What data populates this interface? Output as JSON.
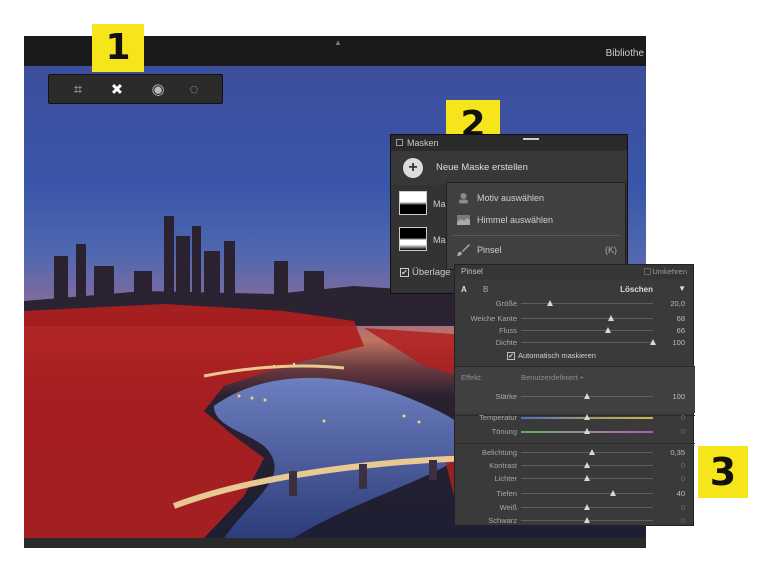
{
  "topbar": {
    "library_label": "Bibliothe"
  },
  "tools": [
    {
      "name": "crop-icon",
      "glyph": "⌗"
    },
    {
      "name": "healing-bandage-icon",
      "glyph": "✚"
    },
    {
      "name": "red-eye-icon",
      "glyph": "◉"
    },
    {
      "name": "masking-icon",
      "glyph": "◌"
    }
  ],
  "badges": {
    "one": "1",
    "two": "2",
    "three": "3"
  },
  "masks_panel": {
    "title": "Masken",
    "new_mask_label": "Neue Maske erstellen",
    "mask1_name": "Ma",
    "mask2_name": "Ma",
    "overlay_label": "Überlage",
    "overlay_check": "✔"
  },
  "menu": {
    "items": [
      {
        "label": "Motiv auswählen",
        "icon": "person-select-icon"
      },
      {
        "label": "Himmel auswählen",
        "icon": "sky-select-icon"
      },
      {
        "label": "Pinsel",
        "icon": "brush-icon",
        "shortcut": "(K)"
      }
    ]
  },
  "brush_panel": {
    "title": "Pinsel",
    "invert_label": "Umkehren",
    "tab_a": "A",
    "tab_b": "B",
    "delete_label": "Löschen",
    "arrow": "▼",
    "brush_sliders": [
      {
        "label": "Größe",
        "value": "20,0",
        "position": 0.22
      },
      {
        "label": "Weiche Kante",
        "value": "68",
        "position": 0.68
      },
      {
        "label": "Fluss",
        "value": "66",
        "position": 0.66
      },
      {
        "label": "Dichte",
        "value": "100",
        "position": 1.0
      }
    ],
    "auto_mask_label": "Automatisch maskieren",
    "auto_mask_check": "✔",
    "effect_label": "Effekt:",
    "effect_value": "Benutzerdefiniert ÷",
    "amount": {
      "label": "Stärke",
      "value": "100",
      "position": 0.5
    },
    "color_sliders": [
      {
        "label": "Temperatur",
        "value": "0",
        "position": 0.5
      },
      {
        "label": "Tönung",
        "value": "0",
        "position": 0.5
      }
    ],
    "tone_sliders": [
      {
        "label": "Belichtung",
        "value": "0,35",
        "position": 0.54,
        "active": true
      },
      {
        "label": "Kontrast",
        "value": "0",
        "position": 0.5,
        "active": false
      },
      {
        "label": "Lichter",
        "value": "0",
        "position": 0.5,
        "active": false
      },
      {
        "label": "Tiefen",
        "value": "40",
        "position": 0.7,
        "active": true
      },
      {
        "label": "Weiß",
        "value": "0",
        "position": 0.5,
        "active": false
      },
      {
        "label": "Schwarz",
        "value": "0",
        "position": 0.5,
        "active": false
      }
    ]
  }
}
